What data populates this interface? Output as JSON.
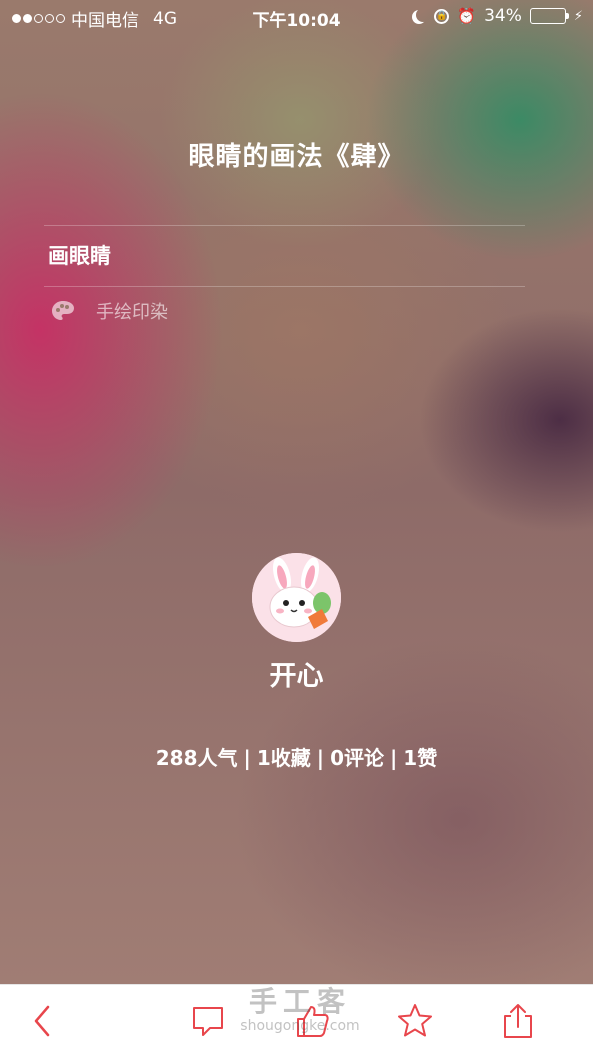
{
  "status_bar": {
    "carrier": "中国电信",
    "network": "4G",
    "time": "下午10:04",
    "battery_percent": "34%",
    "battery_level": 0.34,
    "signal_dots_filled": 2,
    "signal_dots_total": 5
  },
  "article": {
    "title": "眼睛的画法《肆》",
    "subtitle": "画眼睛",
    "category": "手绘印染",
    "category_icon": "palette-icon"
  },
  "author": {
    "name": "开心",
    "avatar_icon": "bunny-avatar"
  },
  "stats": {
    "views": "288人气",
    "favorites": "1收藏",
    "comments": "0评论",
    "likes": "1赞",
    "separator": "|"
  },
  "toolbar": {
    "icons": [
      "back-icon",
      "comment-icon",
      "like-icon",
      "star-icon",
      "share-icon"
    ]
  },
  "watermark": {
    "cn": "手工客",
    "en": "shougongke.com"
  },
  "colors": {
    "accent": "#e8464c",
    "battery_fill": "#4cd964"
  }
}
